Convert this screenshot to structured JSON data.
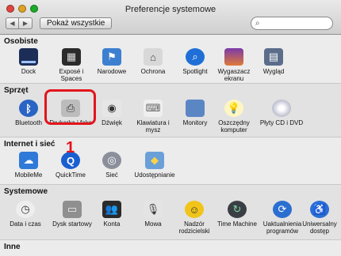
{
  "window": {
    "title": "Preferencje systemowe"
  },
  "toolbar": {
    "back_glyph": "◀",
    "forward_glyph": "▶",
    "show_all_label": "Pokaż wszystkie",
    "search_value": ""
  },
  "sections": [
    {
      "title": "Osobiste",
      "panes": [
        {
          "label": "Dock",
          "icon": "dock-icon"
        },
        {
          "label": "Exposé i Spaces",
          "icon": "expose-icon"
        },
        {
          "label": "Narodowe",
          "icon": "flag-icon"
        },
        {
          "label": "Ochrona",
          "icon": "house-lock-icon"
        },
        {
          "label": "Spotlight",
          "icon": "spotlight-icon"
        },
        {
          "label": "Wygaszacz ekranu",
          "icon": "screensaver-icon"
        },
        {
          "label": "Wygląd",
          "icon": "appearance-icon"
        }
      ]
    },
    {
      "title": "Sprzęt",
      "panes": [
        {
          "label": "Bluetooth",
          "icon": "bluetooth-icon"
        },
        {
          "label": "Drukarka i faks",
          "icon": "printer-icon"
        },
        {
          "label": "Dźwięk",
          "icon": "speaker-icon"
        },
        {
          "label": "Klawiatura i mysz",
          "icon": "keyboard-mouse-icon"
        },
        {
          "label": "Monitory",
          "icon": "monitor-icon"
        },
        {
          "label": "Oszczędny komputer",
          "icon": "lightbulb-icon"
        },
        {
          "label": "Płyty CD i DVD",
          "icon": "disc-icon"
        }
      ]
    },
    {
      "title": "Internet i sieć",
      "panes": [
        {
          "label": "MobileMe",
          "icon": "cloud-icon"
        },
        {
          "label": "QuickTime",
          "icon": "quicktime-icon"
        },
        {
          "label": "Sieć",
          "icon": "network-icon"
        },
        {
          "label": "Udostępnianie",
          "icon": "sharing-icon"
        }
      ]
    },
    {
      "title": "Systemowe",
      "panes": [
        {
          "label": "Data i czas",
          "icon": "clock-icon"
        },
        {
          "label": "Dysk startowy",
          "icon": "disk-icon"
        },
        {
          "label": "Konta",
          "icon": "accounts-icon"
        },
        {
          "label": "Mowa",
          "icon": "microphone-icon"
        },
        {
          "label": "Nadzór rodzicielski",
          "icon": "parental-icon"
        },
        {
          "label": "Time Machine",
          "icon": "time-machine-icon"
        },
        {
          "label": "Uaktualnienia programów",
          "icon": "update-icon"
        },
        {
          "label": "Uniwersalny dostęp",
          "icon": "accessibility-icon"
        }
      ]
    },
    {
      "title": "Inne",
      "panes": []
    }
  ],
  "annotation": {
    "step_number": "1",
    "color": "#e3141b"
  },
  "colors": {
    "accent": "#e3141b"
  }
}
